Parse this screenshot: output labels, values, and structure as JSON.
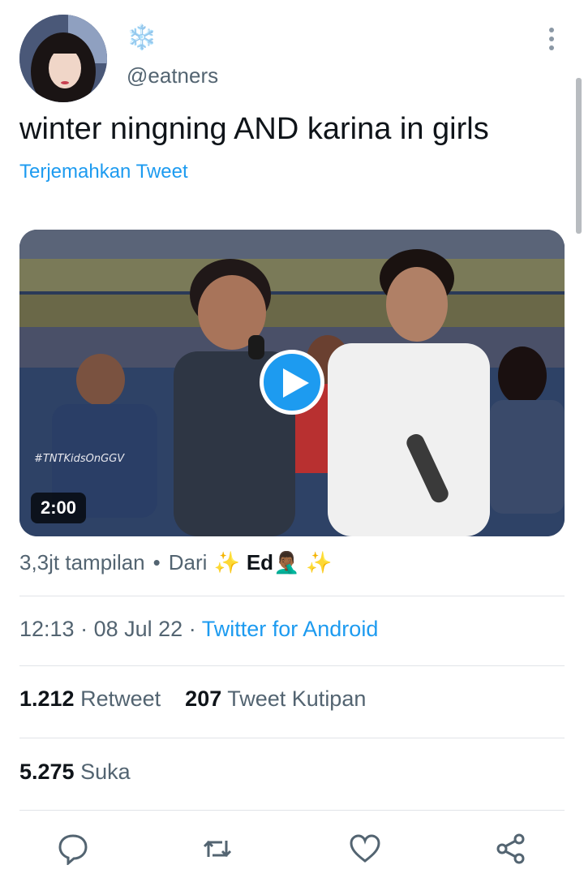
{
  "author": {
    "display_name": "❄️",
    "handle": "@eatners"
  },
  "tweet": {
    "text": "winter ningning AND karina in girls",
    "translate_label": "Terjemahkan Tweet"
  },
  "media": {
    "duration": "2:00",
    "overlay_text": "#TNTKidsOnGGV"
  },
  "views": {
    "count_label": "3,3jt tampilan",
    "separator": "•",
    "from_label": "Dari",
    "sparkle_left": "✨",
    "owner_name": "Ed",
    "owner_emoji": "🤦🏾‍♂️",
    "sparkle_right": "✨"
  },
  "meta": {
    "time": "12:13",
    "dot1": "·",
    "date": "08 Jul 22",
    "dot2": "·",
    "source": "Twitter for Android"
  },
  "stats": {
    "retweets_count": "1.212",
    "retweets_label": "Retweet",
    "quotes_count": "207",
    "quotes_label": "Tweet Kutipan",
    "likes_count": "5.275",
    "likes_label": "Suka"
  },
  "actions": [
    "reply-icon",
    "retweet-icon",
    "like-icon",
    "share-icon"
  ],
  "colors": {
    "accent": "#1d9bf0",
    "secondary_text": "#536471",
    "primary_text": "#0f1419"
  }
}
